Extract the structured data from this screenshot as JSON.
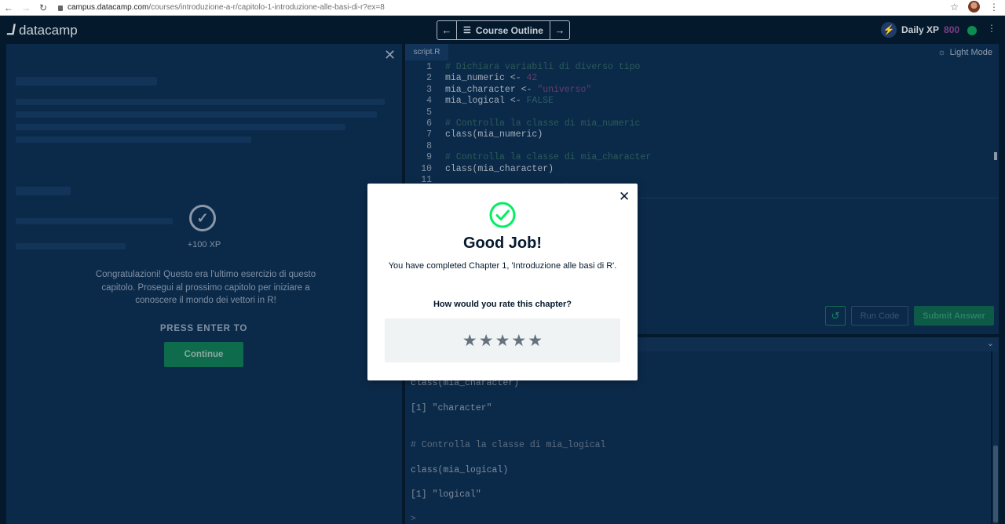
{
  "browser": {
    "url_host": "campus.datacamp.com",
    "url_path": "/courses/introduzione-a-r/capitolo-1-introduzione-alle-basi-di-r?ex=8"
  },
  "header": {
    "logo_text": "datacamp",
    "course_outline_label": "Course Outline",
    "daily_xp_label": "Daily XP",
    "daily_xp_value": "800"
  },
  "left_panel": {
    "xp_award": "+100 XP",
    "message": "Congratulazioni! Questo era l'ultimo esercizio di questo capitolo. Prosegui al prossimo capitolo per iniziare a conoscere il mondo dei vettori in R!",
    "press_enter": "PRESS ENTER TO",
    "continue_label": "Continue"
  },
  "editor": {
    "tab_label": "script.R",
    "light_mode_label": "Light Mode",
    "line_numbers": [
      "1",
      "2",
      "3",
      "4",
      "5",
      "6",
      "7",
      "8",
      "9",
      "10",
      "11"
    ],
    "lines": {
      "l1": "# Dichiara variabili di diverso tipo",
      "l2_var": "mia_numeric <- ",
      "l2_val": "42",
      "l3_var": "mia_character <- ",
      "l3_val": "\"universo\"",
      "l4_var": "mia_logical <- ",
      "l4_val": "FALSE",
      "l6": "# Controlla la classe di mia_numeric",
      "l7": "class(mia_numeric)",
      "l9": "# Controlla la classe di mia_character",
      "l10": "class(mia_character)"
    },
    "run_label": "Run Code",
    "submit_label": "Submit Answer"
  },
  "console": {
    "lines": [
      "class(mia_character)",
      "[1] \"character\"",
      "# Controlla la classe di mia_logical",
      "class(mia_logical)",
      "[1] \"logical\""
    ],
    "prompt": ">"
  },
  "modal": {
    "title": "Good Job!",
    "message": "You have completed Chapter 1, 'Introduzione alle basi di R'.",
    "question": "How would you rate this chapter?",
    "rating": 0,
    "max_rating": 5,
    "accent_color": "#03ef62"
  }
}
